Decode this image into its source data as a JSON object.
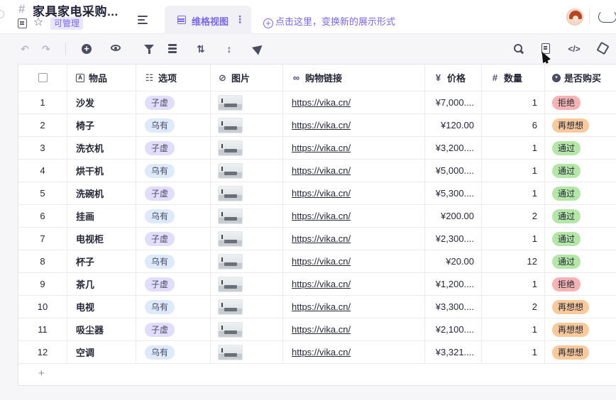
{
  "header": {
    "title": "家具家电采购...",
    "permission_badge": "可管理",
    "active_tab_label": "维格视图",
    "tab_more": "⋮",
    "add_view_text": "点击这里，变换新的展示形式",
    "add_view_icon": "plus-circle-icon"
  },
  "toolbar": {
    "icons": [
      "undo-icon",
      "redo-icon",
      "add-record-icon",
      "hide-fields-icon",
      "filter-icon",
      "group-icon",
      "sort-icon",
      "row-height-icon",
      "share-icon",
      "search-icon",
      "form-icon",
      "api-icon",
      "widget-icon"
    ]
  },
  "grid": {
    "columns": [
      {
        "label": "",
        "icon": "checkbox"
      },
      {
        "label": "物品",
        "icon": "text-field-icon"
      },
      {
        "label": "选项",
        "icon": "multi-select-icon"
      },
      {
        "label": "图片",
        "icon": "attachment-icon"
      },
      {
        "label": "购物链接",
        "icon": "link-icon"
      },
      {
        "label": "价格",
        "icon": "currency-icon"
      },
      {
        "label": "数量",
        "icon": "number-icon"
      },
      {
        "label": "是否购买",
        "icon": "single-select-icon"
      }
    ],
    "header_glyphs": {
      "text": "A",
      "options": "☷",
      "attachment": "⊘",
      "link": "∞",
      "currency": "¥",
      "number": "#",
      "select": "▾"
    },
    "rows": [
      {
        "num": "1",
        "name": "沙发",
        "option": "子虚",
        "link": "https://vika.cn/",
        "price": "¥7,000....",
        "qty": "1",
        "status": "拒绝",
        "status_type": "reject"
      },
      {
        "num": "2",
        "name": "椅子",
        "option": "乌有",
        "link": "https://vika.cn/",
        "price": "¥120.00",
        "qty": "6",
        "status": "再想想",
        "status_type": "think"
      },
      {
        "num": "3",
        "name": "洗衣机",
        "option": "子虚",
        "link": "https://vika.cn/",
        "price": "¥3,200....",
        "qty": "1",
        "status": "通过",
        "status_type": "pass"
      },
      {
        "num": "4",
        "name": "烘干机",
        "option": "乌有",
        "link": "https://vika.cn/",
        "price": "¥5,000....",
        "qty": "1",
        "status": "通过",
        "status_type": "pass"
      },
      {
        "num": "5",
        "name": "洗碗机",
        "option": "子虚",
        "link": "https://vika.cn/",
        "price": "¥5,300....",
        "qty": "1",
        "status": "通过",
        "status_type": "pass"
      },
      {
        "num": "6",
        "name": "挂画",
        "option": "乌有",
        "link": "https://vika.cn/",
        "price": "¥200.00",
        "qty": "2",
        "status": "通过",
        "status_type": "pass"
      },
      {
        "num": "7",
        "name": "电视柜",
        "option": "子虚",
        "link": "https://vika.cn/",
        "price": "¥2,300....",
        "qty": "1",
        "status": "通过",
        "status_type": "pass"
      },
      {
        "num": "8",
        "name": "杯子",
        "option": "乌有",
        "link": "https://vika.cn/",
        "price": "¥20.00",
        "qty": "12",
        "status": "通过",
        "status_type": "pass"
      },
      {
        "num": "9",
        "name": "茶几",
        "option": "子虚",
        "link": "https://vika.cn/",
        "price": "¥1,200....",
        "qty": "1",
        "status": "拒绝",
        "status_type": "reject"
      },
      {
        "num": "10",
        "name": "电视",
        "option": "乌有",
        "link": "https://vika.cn/",
        "price": "¥3,300....",
        "qty": "2",
        "status": "再想想",
        "status_type": "think"
      },
      {
        "num": "11",
        "name": "吸尘器",
        "option": "子虚",
        "link": "https://vika.cn/",
        "price": "¥2,100....",
        "qty": "1",
        "status": "再想想",
        "status_type": "think"
      },
      {
        "num": "12",
        "name": "空调",
        "option": "乌有",
        "link": "https://vika.cn/",
        "price": "¥3,321....",
        "qty": "1",
        "status": "再想想",
        "status_type": "think"
      }
    ],
    "add_row_label": "+"
  },
  "colors": {
    "accent": "#7b67ee",
    "status_reject": "#f6b3b3",
    "status_pass": "#b3e6a7",
    "status_think": "#f8c99a",
    "option_zixu": "#e3ddfd",
    "option_wuyou": "#dde9fd"
  }
}
